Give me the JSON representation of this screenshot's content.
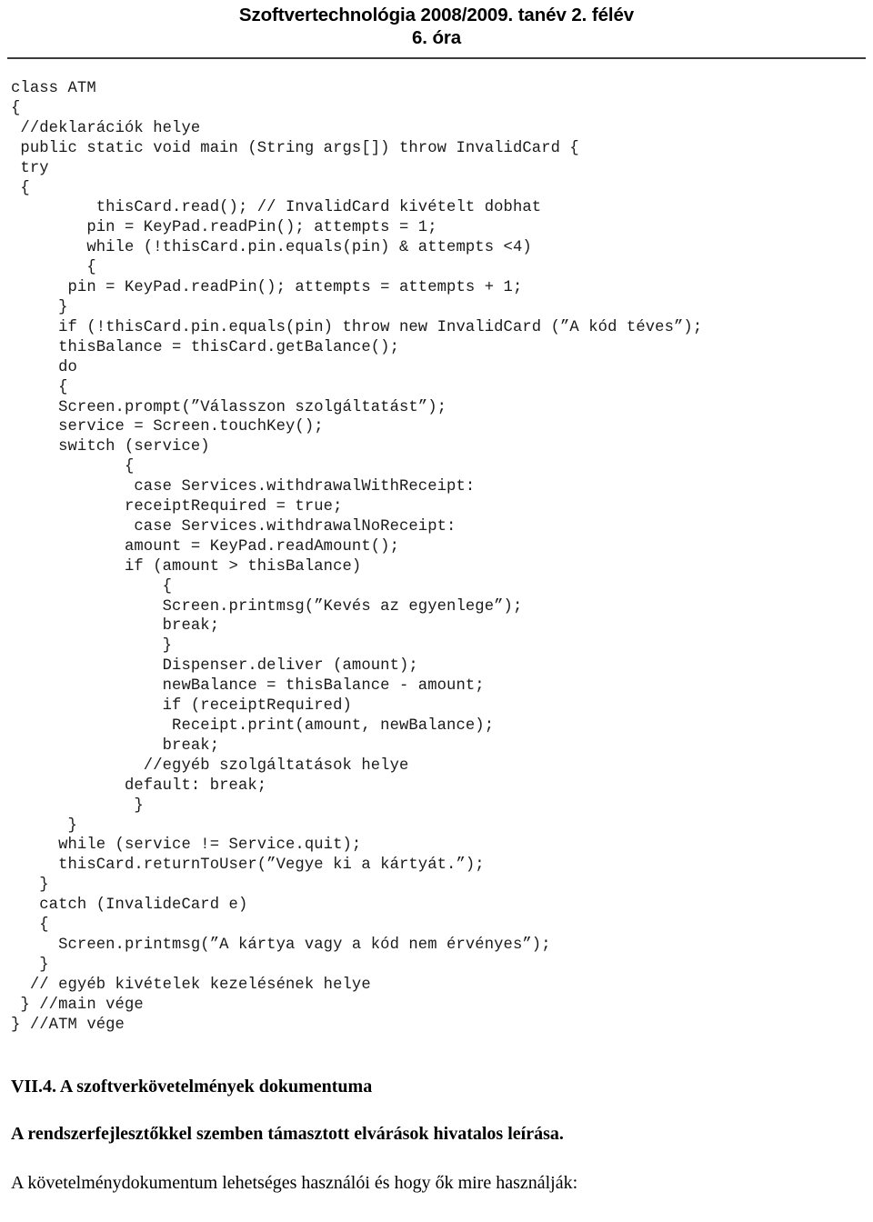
{
  "header": {
    "title_line_1": "Szoftvertechnológia 2008/2009. tanév 2. félév",
    "title_line_2": "6. óra",
    "rule_color": "#3a3a3a"
  },
  "code": {
    "language_hint": "java",
    "lines": [
      "class ATM",
      "{",
      " //deklarációk helye",
      " public static void main (String args[]) throw InvalidCard {",
      " try",
      " {",
      "         thisCard.read(); // InvalidCard kivételt dobhat",
      "        pin = KeyPad.readPin(); attempts = 1;",
      "        while (!thisCard.pin.equals(pin) & attempts <4)",
      "        {",
      "      pin = KeyPad.readPin(); attempts = attempts + 1;",
      "     }",
      "     if (!thisCard.pin.equals(pin) throw new InvalidCard (”A kód téves”);",
      "     thisBalance = thisCard.getBalance();",
      "     do",
      "     {",
      "     Screen.prompt(”Válasszon szolgáltatást”);",
      "     service = Screen.touchKey();",
      "     switch (service)",
      "            {",
      "             case Services.withdrawalWithReceipt:",
      "            receiptRequired = true;",
      "             case Services.withdrawalNoReceipt:",
      "            amount = KeyPad.readAmount();",
      "            if (amount > thisBalance)",
      "                {",
      "                Screen.printmsg(”Kevés az egyenlege”);",
      "                break;",
      "                }",
      "                Dispenser.deliver (amount);",
      "                newBalance = thisBalance - amount;",
      "                if (receiptRequired)",
      "                 Receipt.print(amount, newBalance);",
      "                break;",
      "              //egyéb szolgáltatások helye",
      "            default: break;",
      "             }",
      "      }",
      "     while (service != Service.quit);",
      "     thisCard.returnToUser(”Vegye ki a kártyát.”);",
      "   }",
      "   catch (InvalideCard e)",
      "   {",
      "     Screen.printmsg(”A kártya vagy a kód nem érvényes”);",
      "   }",
      "  // egyéb kivételek kezelésének helye",
      " } //main vége",
      "} //ATM vége"
    ]
  },
  "section": {
    "heading": "VII.4. A szoftverkövetelmények dokumentuma",
    "lead": "A rendszerfejlesztőkkel szemben támasztott elvárások hivatalos leírása.",
    "body": "A követelménydokumentum lehetséges használói és hogy ők mire használják:"
  }
}
